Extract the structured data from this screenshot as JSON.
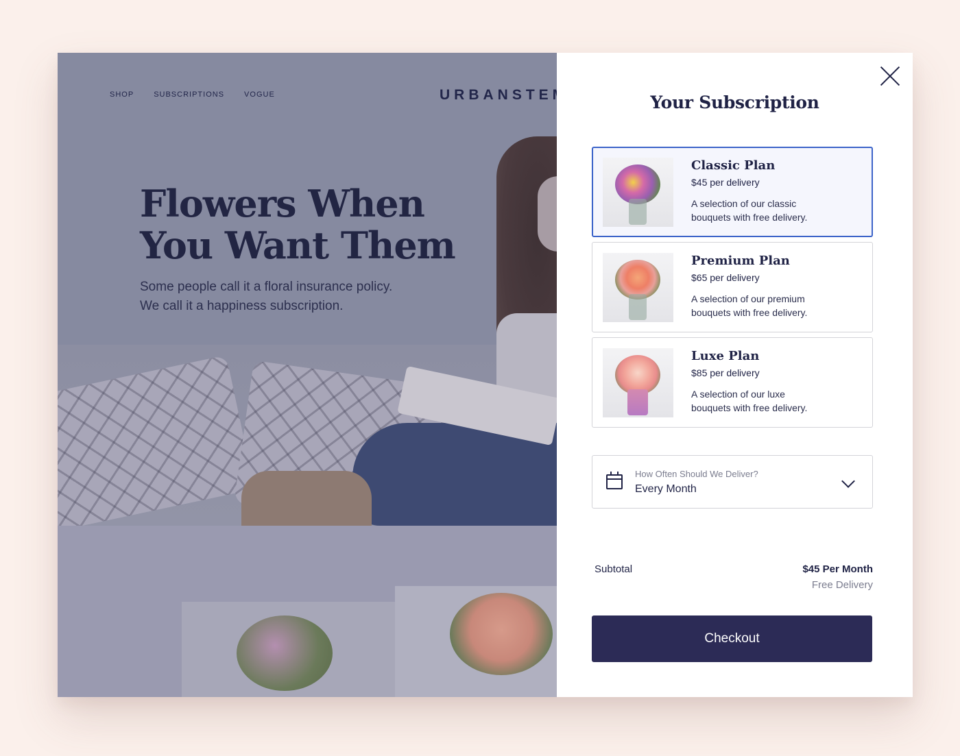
{
  "site": {
    "nav": [
      "SHOP",
      "SUBSCRIPTIONS",
      "VOGUE"
    ],
    "logo": "URBANSTEMS",
    "hero_title_line1": "Flowers When",
    "hero_title_line2": "You Want Them",
    "hero_sub_line1": "Some people call it a floral insurance policy.",
    "hero_sub_line2": "We call it a happiness subscription."
  },
  "drawer": {
    "title": "Your Subscription",
    "close_icon": "close-icon",
    "plans": [
      {
        "name": "Classic Plan",
        "price": "$45 per delivery",
        "desc_line1": "A selection of our classic",
        "desc_line2": "bouquets with free delivery.",
        "selected": true
      },
      {
        "name": "Premium Plan",
        "price": "$65 per delivery",
        "desc_line1": "A selection of our premium",
        "desc_line2": "bouquets with free delivery.",
        "selected": false
      },
      {
        "name": "Luxe Plan",
        "price": "$85 per delivery",
        "desc_line1": "A selection of our luxe",
        "desc_line2": "bouquets with free delivery.",
        "selected": false
      }
    ],
    "frequency": {
      "label": "How Often Should We Deliver?",
      "value": "Every Month",
      "icon": "calendar-icon"
    },
    "subtotal": {
      "label": "Subtotal",
      "value": "$45 Per Month",
      "note": "Free Delivery"
    },
    "checkout_label": "Checkout"
  },
  "colors": {
    "navy": "#1f2245",
    "button": "#2c2b56",
    "selected_border": "#3b63c9",
    "page_bg": "#fbf0eb",
    "overlay": "#8a8ea3"
  }
}
